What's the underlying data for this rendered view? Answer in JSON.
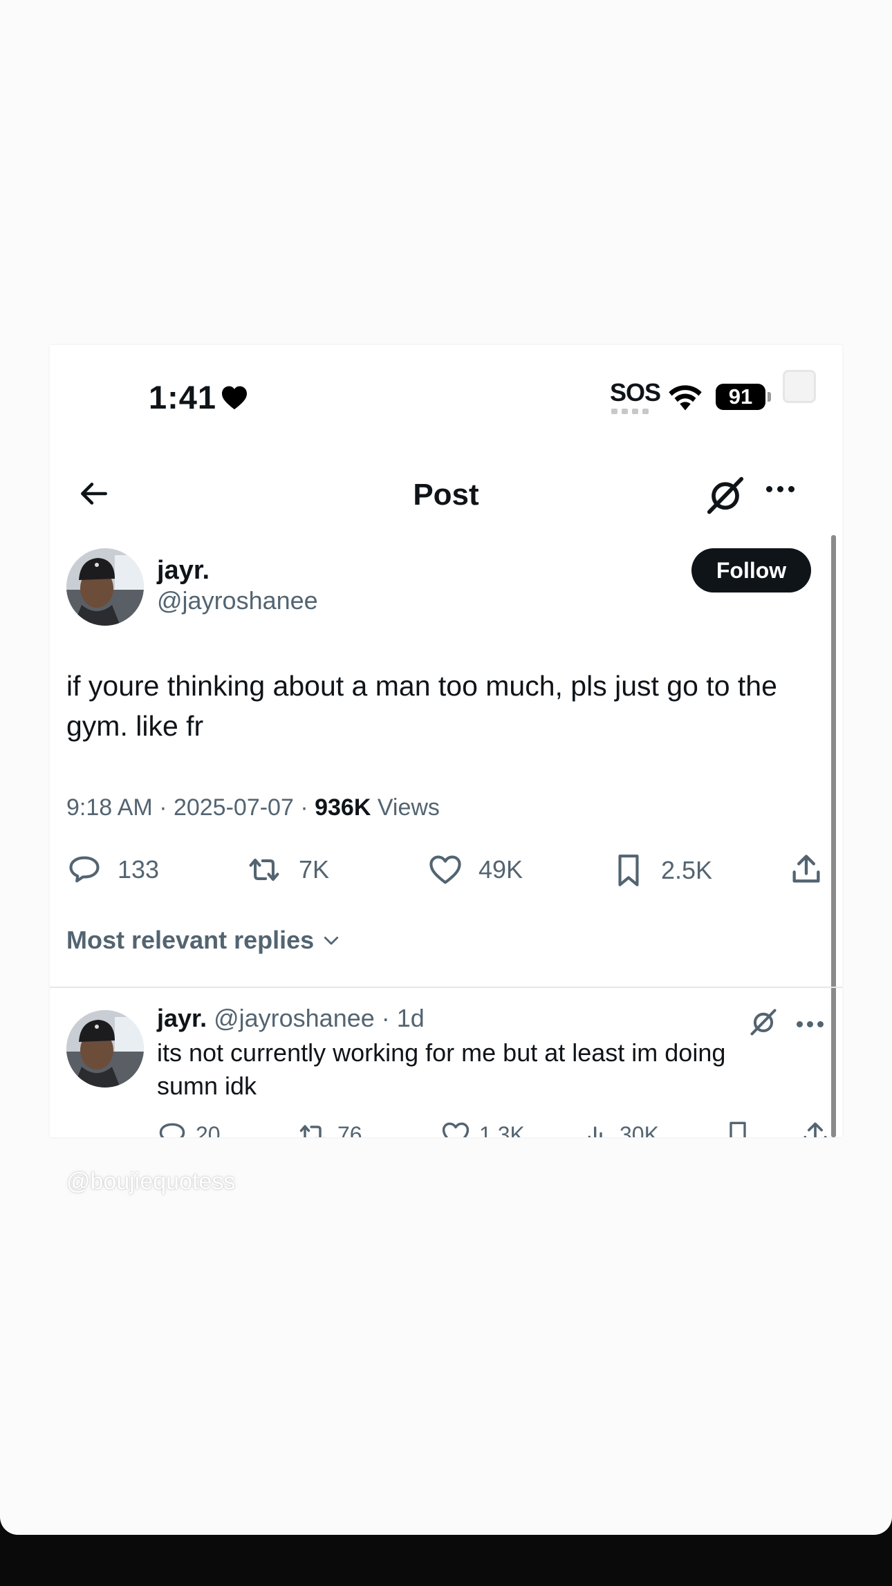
{
  "status_bar": {
    "time": "1:41",
    "sos": "SOS",
    "battery": "91"
  },
  "nav": {
    "title": "Post"
  },
  "post": {
    "author_name": "jayr.",
    "author_handle": "@jayroshanee",
    "follow_label": "Follow",
    "text": "if youre thinking about a man too much, pls just go to the gym. like fr",
    "time": "9:18 AM · 2025-07-07 · ",
    "views_count": "936K",
    "views_label": " Views",
    "replies": "133",
    "reposts": "7K",
    "likes": "49K",
    "bookmarks": "2.5K"
  },
  "sort": {
    "label": "Most relevant replies"
  },
  "reply": {
    "author_name": "jayr.",
    "meta": " @jayroshanee · 1d",
    "text": "its not currently working for me but at least im doing sumn idk",
    "replies": "20",
    "reposts": "76",
    "likes": "1.3K",
    "views": "30K"
  },
  "watermark": "@boujiequotess",
  "colors": {
    "primary_text": "#0f1419",
    "secondary_text": "#536471",
    "follow_bg": "#0f1419",
    "divider": "#e7e7e7",
    "page_bg": "#fbfbfb",
    "bottom_bar": "#0a0a0a"
  }
}
